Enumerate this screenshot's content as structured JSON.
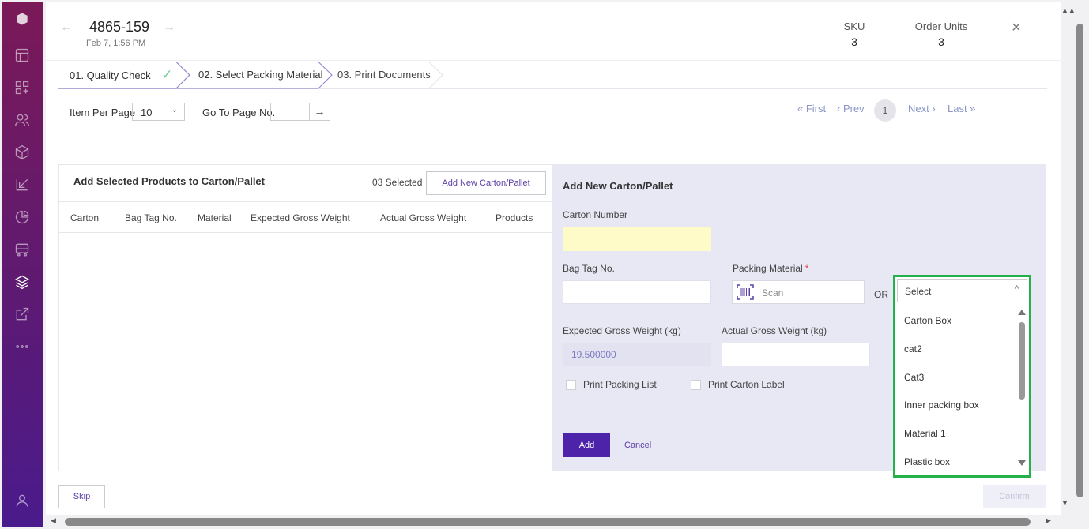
{
  "sidebar": {
    "icons": [
      "logo-icon",
      "layout-icon",
      "grid-icon",
      "users-icon",
      "box-icon",
      "import-icon",
      "pie-chart-icon",
      "truck-icon",
      "layers-icon",
      "external-link-icon",
      "more-icon",
      "user-icon"
    ],
    "active": "layers-icon"
  },
  "header": {
    "order_id": "4865-159",
    "order_date": "Feb 7, 1:56 PM",
    "sku_label": "SKU",
    "sku_value": "3",
    "order_units_label": "Order Units",
    "order_units_value": "3",
    "prev_arrow": "←",
    "next_arrow": "→",
    "close": "×"
  },
  "stepper": {
    "steps": [
      {
        "label": "01. Quality Check",
        "state": "done"
      },
      {
        "label": "02. Select Packing Material",
        "state": "current"
      },
      {
        "label": "03. Print Documents",
        "state": "pending"
      }
    ],
    "check": "✓"
  },
  "toolbar": {
    "items_per_page_label": "Item Per Page",
    "items_per_page_value": "10",
    "go_to_page_label": "Go To Page No.",
    "go_arrow": "→"
  },
  "pagination": {
    "first": "« First",
    "prev": "‹ Prev",
    "current": "1",
    "next": "Next ›",
    "last": "Last »"
  },
  "left_panel": {
    "title": "Add Selected Products to Carton/Pallet",
    "selected_count": "03 Selected",
    "add_button": "Add New Carton/Pallet",
    "columns": [
      "Carton",
      "Bag Tag No.",
      "Material",
      "Expected Gross Weight",
      "Actual Gross Weight",
      "Products"
    ]
  },
  "right_panel": {
    "title": "Add New Carton/Pallet",
    "carton_number_label": "Carton Number",
    "carton_number_value": "",
    "bag_tag_label": "Bag Tag No.",
    "packing_material_label": "Packing Material",
    "required_mark": "*",
    "scan_placeholder": "Scan",
    "or_text": "OR",
    "expected_weight_label": "Expected Gross Weight (kg)",
    "expected_weight_value": "19.500000",
    "actual_weight_label": "Actual Gross Weight (kg)",
    "print_packing_list": "Print Packing List",
    "print_carton_label": "Print Carton Label",
    "add_button": "Add",
    "cancel_button": "Cancel"
  },
  "dropdown": {
    "selected": "Select",
    "options": [
      "Carton Box",
      "cat2",
      "Cat3",
      "Inner packing box",
      "Material 1",
      "Plastic box"
    ],
    "highlight_color": "#24b14a"
  },
  "footer": {
    "skip_button": "Skip",
    "confirm_button": "Confirm"
  },
  "colors": {
    "sidebar_top": "#7b1957",
    "sidebar_bottom": "#4a1b8c",
    "primary": "#4c23a9",
    "link": "#5b3fa8",
    "panel_bg": "#e8e8f5"
  }
}
